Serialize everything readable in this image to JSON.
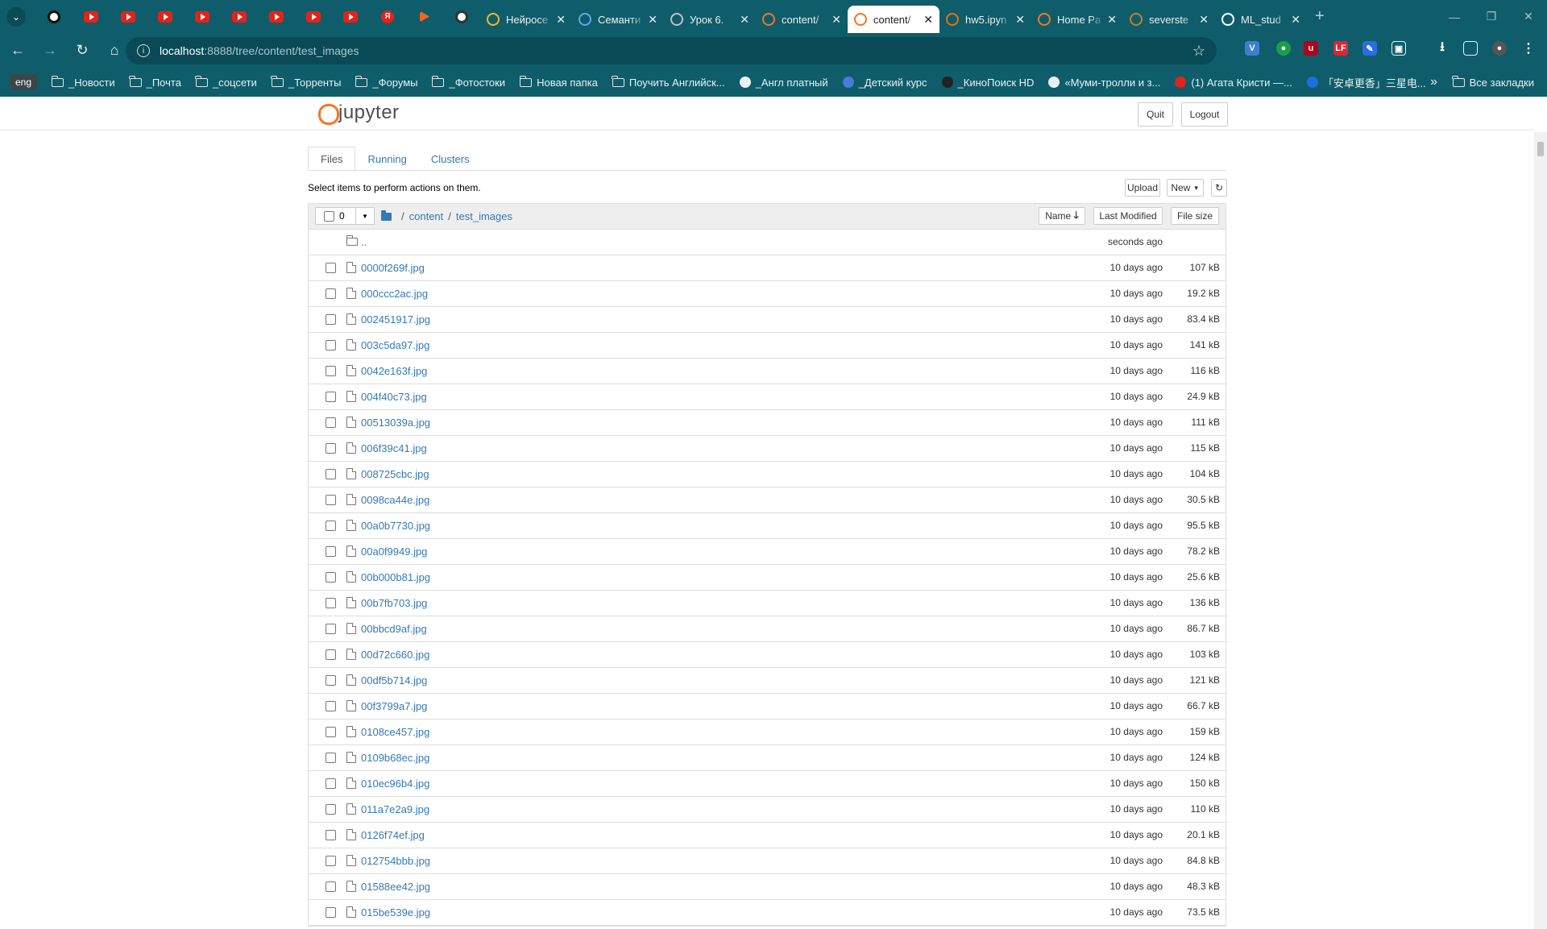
{
  "browser": {
    "tabs": [
      {
        "title": "Нейросе",
        "favicon": "chain-icon",
        "color": "#f5b82e"
      },
      {
        "title": "Семанти",
        "favicon": "app-icon",
        "color": "#5fa8e6"
      },
      {
        "title": "Урок 6.",
        "favicon": "globe-icon",
        "color": "#c0c0c0"
      },
      {
        "title": "content/",
        "favicon": "jupyter-icon",
        "color": "#f37626"
      },
      {
        "title": "content/",
        "favicon": "jupyter-icon",
        "color": "#f37626",
        "active": true
      },
      {
        "title": "hw5.ipyn",
        "favicon": "colab-icon",
        "color": "#e8710a"
      },
      {
        "title": "Home Pa",
        "favicon": "jupyter-icon",
        "color": "#f37626"
      },
      {
        "title": "severste",
        "favicon": "kaggle-icon",
        "color": "#c97b2f"
      },
      {
        "title": "ML_stud",
        "favicon": "github-icon",
        "color": "#ffffff"
      }
    ],
    "url_host": "localhost",
    "url_path": ":8888/tree/content/test_images",
    "bookmarks_lang": "eng",
    "bookmarks": [
      {
        "label": "_Новости",
        "type": "folder"
      },
      {
        "label": "_Почта",
        "type": "folder"
      },
      {
        "label": "_соцсети",
        "type": "folder"
      },
      {
        "label": "_Торренты",
        "type": "folder"
      },
      {
        "label": "_Форумы",
        "type": "folder"
      },
      {
        "label": "_Фотостоки",
        "type": "folder"
      },
      {
        "label": "Новая папка",
        "type": "folder"
      },
      {
        "label": "Поучить Английск...",
        "type": "folder"
      },
      {
        "label": "_Англ платный",
        "type": "site",
        "color": "#e8f1f2"
      },
      {
        "label": "_Детский курс",
        "type": "site",
        "color": "#4a7bd8"
      },
      {
        "label": "_КиноПоиск HD",
        "type": "site",
        "color": "#222222"
      },
      {
        "label": "«Муми-тролли и з...",
        "type": "site",
        "color": "#e8f1f2"
      },
      {
        "label": "(1) Агата Кристи —...",
        "type": "site",
        "color": "#e62117"
      },
      {
        "label": "「安卓更香」三星电...",
        "type": "site",
        "color": "#1e6fd9"
      }
    ],
    "all_bookmarks": "Все закладки"
  },
  "jupyter": {
    "logo_text": "jupyter",
    "quit_label": "Quit",
    "logout_label": "Logout",
    "tabs": [
      "Files",
      "Running",
      "Clusters"
    ],
    "hint": "Select items to perform actions on them.",
    "upload_label": "Upload",
    "new_label": "New",
    "selected_count": "0",
    "breadcrumb": [
      "content",
      "test_images"
    ],
    "sort_name": "Name",
    "sort_modified": "Last Modified",
    "sort_size": "File size",
    "parent": {
      "name": "..",
      "modified": "seconds ago"
    },
    "files": [
      {
        "name": "0000f269f.jpg",
        "modified": "10 days ago",
        "size": "107 kB"
      },
      {
        "name": "000ccc2ac.jpg",
        "modified": "10 days ago",
        "size": "19.2 kB"
      },
      {
        "name": "002451917.jpg",
        "modified": "10 days ago",
        "size": "83.4 kB"
      },
      {
        "name": "003c5da97.jpg",
        "modified": "10 days ago",
        "size": "141 kB"
      },
      {
        "name": "0042e163f.jpg",
        "modified": "10 days ago",
        "size": "116 kB"
      },
      {
        "name": "004f40c73.jpg",
        "modified": "10 days ago",
        "size": "24.9 kB"
      },
      {
        "name": "00513039a.jpg",
        "modified": "10 days ago",
        "size": "111 kB"
      },
      {
        "name": "006f39c41.jpg",
        "modified": "10 days ago",
        "size": "115 kB"
      },
      {
        "name": "008725cbc.jpg",
        "modified": "10 days ago",
        "size": "104 kB"
      },
      {
        "name": "0098ca44e.jpg",
        "modified": "10 days ago",
        "size": "30.5 kB"
      },
      {
        "name": "00a0b7730.jpg",
        "modified": "10 days ago",
        "size": "95.5 kB"
      },
      {
        "name": "00a0f9949.jpg",
        "modified": "10 days ago",
        "size": "78.2 kB"
      },
      {
        "name": "00b000b81.jpg",
        "modified": "10 days ago",
        "size": "25.6 kB"
      },
      {
        "name": "00b7fb703.jpg",
        "modified": "10 days ago",
        "size": "136 kB"
      },
      {
        "name": "00bbcd9af.jpg",
        "modified": "10 days ago",
        "size": "86.7 kB"
      },
      {
        "name": "00d72c660.jpg",
        "modified": "10 days ago",
        "size": "103 kB"
      },
      {
        "name": "00df5b714.jpg",
        "modified": "10 days ago",
        "size": "121 kB"
      },
      {
        "name": "00f3799a7.jpg",
        "modified": "10 days ago",
        "size": "66.7 kB"
      },
      {
        "name": "0108ce457.jpg",
        "modified": "10 days ago",
        "size": "159 kB"
      },
      {
        "name": "0109b68ec.jpg",
        "modified": "10 days ago",
        "size": "124 kB"
      },
      {
        "name": "010ec96b4.jpg",
        "modified": "10 days ago",
        "size": "150 kB"
      },
      {
        "name": "011a7e2a9.jpg",
        "modified": "10 days ago",
        "size": "110 kB"
      },
      {
        "name": "0126f74ef.jpg",
        "modified": "10 days ago",
        "size": "20.1 kB"
      },
      {
        "name": "012754bbb.jpg",
        "modified": "10 days ago",
        "size": "84.8 kB"
      },
      {
        "name": "01588ee42.jpg",
        "modified": "10 days ago",
        "size": "48.3 kB"
      },
      {
        "name": "015be539e.jpg",
        "modified": "10 days ago",
        "size": "73.5 kB"
      }
    ]
  }
}
